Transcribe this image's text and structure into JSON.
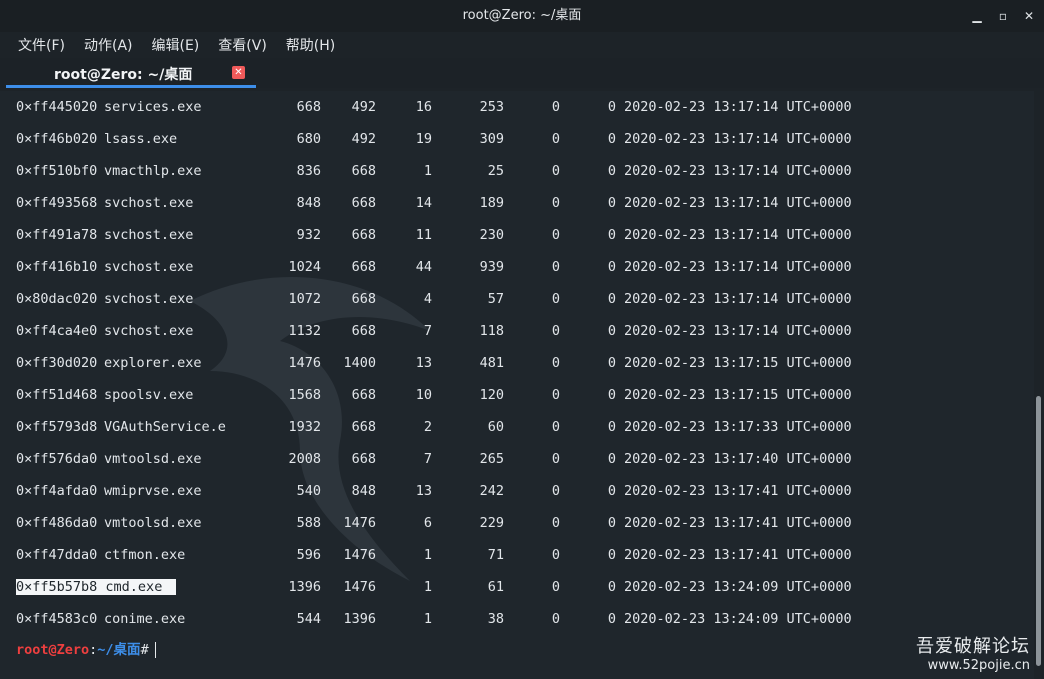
{
  "window": {
    "title": "root@Zero: ~/桌面"
  },
  "controls": {
    "minimize": "▁",
    "maximize": "▫",
    "close": "✕"
  },
  "menu": [
    "文件(F)",
    "动作(A)",
    "编辑(E)",
    "查看(V)",
    "帮助(H)"
  ],
  "tab": {
    "label": "root@Zero: ~/桌面",
    "close_icon": "close-icon"
  },
  "rows": [
    [
      "0×ff445020",
      "services.exe",
      "668",
      "492",
      "16",
      "253",
      "0",
      "0",
      "2020-02-23 13:17:14 UTC+0000"
    ],
    [
      "0×ff46b020",
      "lsass.exe",
      "680",
      "492",
      "19",
      "309",
      "0",
      "0",
      "2020-02-23 13:17:14 UTC+0000"
    ],
    [
      "0×ff510bf0",
      "vmacthlp.exe",
      "836",
      "668",
      "1",
      "25",
      "0",
      "0",
      "2020-02-23 13:17:14 UTC+0000"
    ],
    [
      "0×ff493568",
      "svchost.exe",
      "848",
      "668",
      "14",
      "189",
      "0",
      "0",
      "2020-02-23 13:17:14 UTC+0000"
    ],
    [
      "0×ff491a78",
      "svchost.exe",
      "932",
      "668",
      "11",
      "230",
      "0",
      "0",
      "2020-02-23 13:17:14 UTC+0000"
    ],
    [
      "0×ff416b10",
      "svchost.exe",
      "1024",
      "668",
      "44",
      "939",
      "0",
      "0",
      "2020-02-23 13:17:14 UTC+0000"
    ],
    [
      "0×80dac020",
      "svchost.exe",
      "1072",
      "668",
      "4",
      "57",
      "0",
      "0",
      "2020-02-23 13:17:14 UTC+0000"
    ],
    [
      "0×ff4ca4e0",
      "svchost.exe",
      "1132",
      "668",
      "7",
      "118",
      "0",
      "0",
      "2020-02-23 13:17:14 UTC+0000"
    ],
    [
      "0×ff30d020",
      "explorer.exe",
      "1476",
      "1400",
      "13",
      "481",
      "0",
      "0",
      "2020-02-23 13:17:15 UTC+0000"
    ],
    [
      "0×ff51d468",
      "spoolsv.exe",
      "1568",
      "668",
      "10",
      "120",
      "0",
      "0",
      "2020-02-23 13:17:15 UTC+0000"
    ],
    [
      "0×ff5793d8",
      "VGAuthService.e",
      "1932",
      "668",
      "2",
      "60",
      "0",
      "0",
      "2020-02-23 13:17:33 UTC+0000"
    ],
    [
      "0×ff576da0",
      "vmtoolsd.exe",
      "2008",
      "668",
      "7",
      "265",
      "0",
      "0",
      "2020-02-23 13:17:40 UTC+0000"
    ],
    [
      "0×ff4afda0",
      "wmiprvse.exe",
      "540",
      "848",
      "13",
      "242",
      "0",
      "0",
      "2020-02-23 13:17:41 UTC+0000"
    ],
    [
      "0×ff486da0",
      "vmtoolsd.exe",
      "588",
      "1476",
      "6",
      "229",
      "0",
      "0",
      "2020-02-23 13:17:41 UTC+0000"
    ],
    [
      "0×ff47dda0",
      "ctfmon.exe",
      "596",
      "1476",
      "1",
      "71",
      "0",
      "0",
      "2020-02-23 13:17:41 UTC+0000"
    ],
    [
      "0×ff5b57b8",
      "cmd.exe",
      "1396",
      "1476",
      "1",
      "61",
      "0",
      "0",
      "2020-02-23 13:24:09 UTC+0000"
    ],
    [
      "0×ff4583c0",
      "conime.exe",
      "544",
      "1396",
      "1",
      "38",
      "0",
      "0",
      "2020-02-23 13:24:09 UTC+0000"
    ]
  ],
  "highlighted_row": 15,
  "prompt": {
    "user": "root@Zero",
    "sep": ":",
    "path": "~/桌面",
    "symbol": "#"
  },
  "watermark": {
    "name": "吾爱破解论坛",
    "url": "www.52pojie.cn"
  },
  "colors": {
    "accent": "#3d8ee9",
    "prompt_user": "#ee3f3f",
    "close": "#f05a5a"
  }
}
